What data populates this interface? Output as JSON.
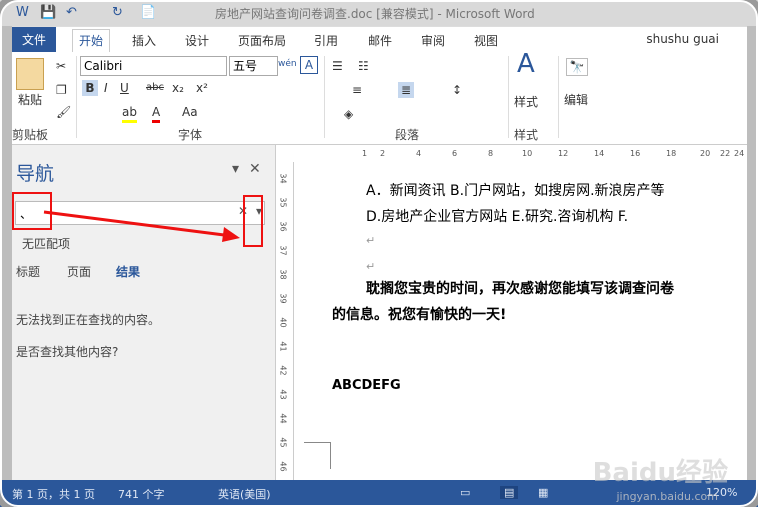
{
  "window": {
    "title": "房地产网站查询问卷调查.doc [兼容模式] - Microsoft Word",
    "quick_access": [
      "W",
      "💾",
      "↶",
      "↻",
      "📄"
    ]
  },
  "ribbon_tabs": [
    "文件",
    "开始",
    "插入",
    "设计",
    "页面布局",
    "引用",
    "邮件",
    "审阅",
    "视图"
  ],
  "active_tab": "开始",
  "user": "shushu guai",
  "ribbon": {
    "clipboard": {
      "paste": "粘贴",
      "label": "剪贴板"
    },
    "font": {
      "name": "Calibri",
      "size": "五号",
      "wen": "wén",
      "a_box": "A",
      "label": "字体"
    },
    "paragraph": {
      "label": "段落"
    },
    "styles": {
      "button": "样式",
      "label": "样式"
    },
    "editing": {
      "button": "编辑"
    }
  },
  "nav": {
    "title": "导航",
    "search_value": "、",
    "no_match": "无匹配项",
    "tabs": [
      "标题",
      "页面",
      "结果"
    ],
    "msg1": "无法找到正在查找的内容。",
    "msg2": "是否查找其他内容?"
  },
  "ruler": {
    "h": [
      "1",
      "2",
      "4",
      "6",
      "8",
      "10",
      "12",
      "14",
      "16",
      "18",
      "20",
      "22",
      "24"
    ],
    "v": [
      "34",
      "35",
      "36",
      "37",
      "38",
      "39",
      "40",
      "41",
      "42",
      "43",
      "44",
      "45",
      "46"
    ]
  },
  "doc": {
    "line1": "A．新闻资讯     B.门户网站，如搜房网.新浪房产等",
    "line2": "D.房地产企业官方网站          E.研究.咨询机构      F.",
    "line3": "耽搁您宝贵的时间，再次感谢您能填写该调查问卷",
    "line4": "的信息。祝您有愉快的一天!",
    "line5": "ABCDEFG"
  },
  "status": {
    "page": "第 1 页，共 1 页",
    "words": "741 个字",
    "lang": "英语(美国)",
    "zoom": "120%"
  },
  "watermark": {
    "main": "Baidu经验",
    "sub": "jingyan.baidu.com"
  }
}
